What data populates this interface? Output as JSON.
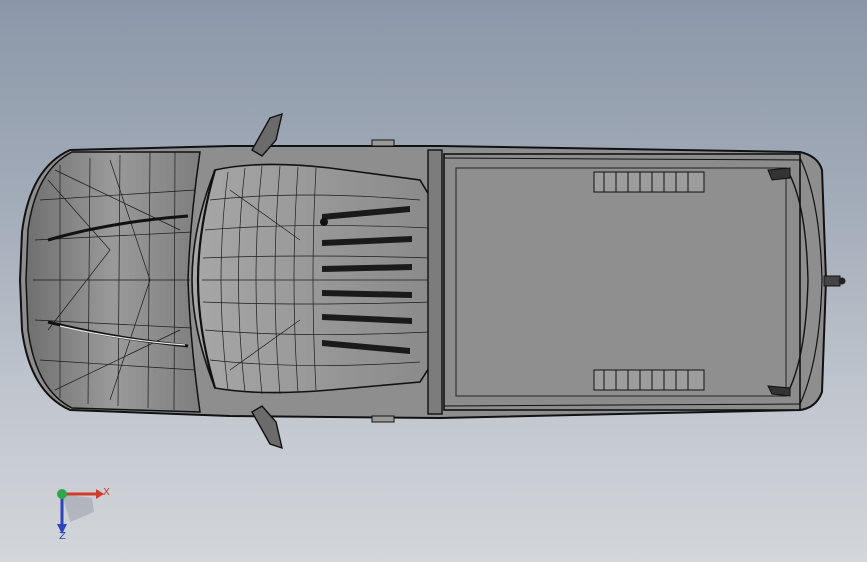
{
  "viewport": {
    "background_top": "#8b97a8",
    "background_bottom": "#d3d6da"
  },
  "model": {
    "subject": "pickup-truck-top-view",
    "render_style": "shaded-with-edges",
    "body_color": "#8e8e8e",
    "edge_color": "#111111"
  },
  "triad": {
    "x_label": "X",
    "z_label": "Z",
    "x_color": "#d23a2a",
    "y_color": "#2fa84a",
    "z_color": "#2d44b8"
  }
}
